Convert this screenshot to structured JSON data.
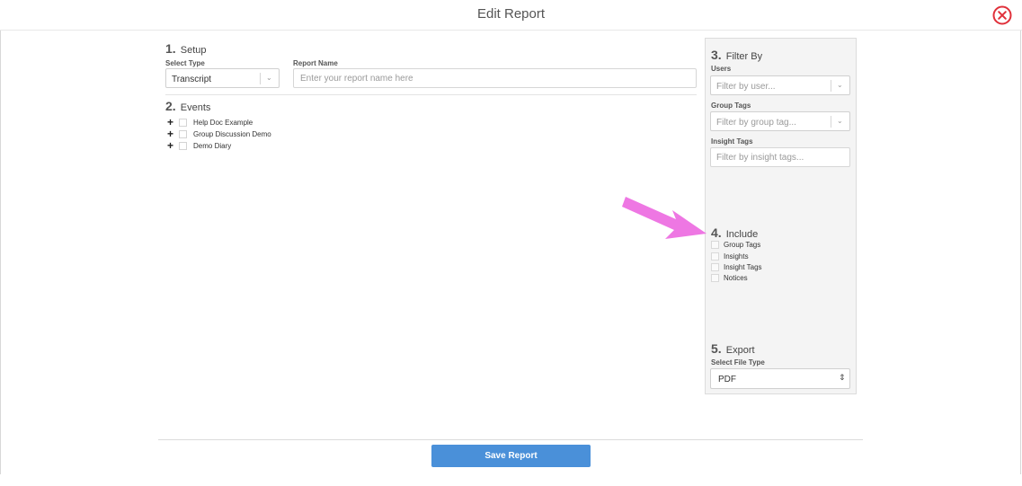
{
  "header": {
    "title": "Edit Report",
    "close_icon": "close-circle-icon"
  },
  "setup": {
    "number": "1.",
    "title": "Setup",
    "select_type_label": "Select Type",
    "select_type_value": "Transcript",
    "report_name_label": "Report Name",
    "report_name_placeholder": "Enter your report name here",
    "report_name_value": ""
  },
  "events": {
    "number": "2.",
    "title": "Events",
    "items": [
      {
        "label": "Help Doc Example"
      },
      {
        "label": "Group Discussion Demo"
      },
      {
        "label": "Demo Diary"
      }
    ]
  },
  "filter": {
    "number": "3.",
    "title": "Filter By",
    "users_label": "Users",
    "users_placeholder": "Filter by user...",
    "group_tags_label": "Group Tags",
    "group_tags_placeholder": "Filter by group tag...",
    "insight_tags_label": "Insight Tags",
    "insight_tags_placeholder": "Filter by insight tags..."
  },
  "include": {
    "number": "4.",
    "title": "Include",
    "items": [
      {
        "label": "Group Tags",
        "checked": false
      },
      {
        "label": "Insights",
        "checked": false
      },
      {
        "label": "Insight Tags",
        "checked": false
      },
      {
        "label": "Notices",
        "checked": false
      }
    ]
  },
  "export": {
    "number": "5.",
    "title": "Export",
    "file_type_label": "Select File Type",
    "file_type_value": "PDF"
  },
  "footer": {
    "save_label": "Save Report"
  },
  "colors": {
    "accent": "#4a90d9",
    "close": "#e0303a",
    "arrow": "#ee77e3"
  }
}
